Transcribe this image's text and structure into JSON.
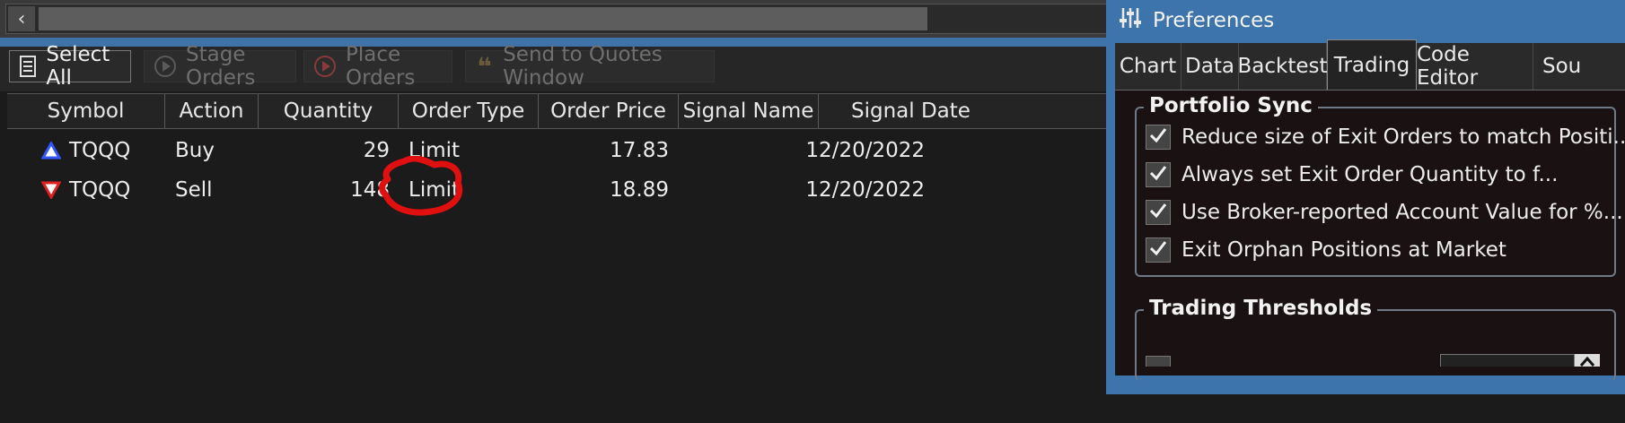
{
  "toolbar": {
    "select_all": "Select All",
    "stage_orders": "Stage Orders",
    "place_orders": "Place Orders",
    "send_to_quotes": "Send to Quotes Window"
  },
  "table": {
    "headers": [
      "Symbol",
      "Action",
      "Quantity",
      "Order Type",
      "Order Price",
      "Signal Name",
      "Signal Date"
    ],
    "rows": [
      {
        "direction": "up",
        "symbol": "TQQQ",
        "action": "Buy",
        "quantity": "29",
        "order_type": "Limit",
        "order_price": "17.83",
        "signal_name": "",
        "signal_date": "12/20/2022"
      },
      {
        "direction": "down",
        "symbol": "TQQQ",
        "action": "Sell",
        "quantity": "148",
        "order_type": "Limit",
        "order_price": "18.89",
        "signal_name": "",
        "signal_date": "12/20/2022"
      }
    ]
  },
  "prefs": {
    "title": "Preferences",
    "tabs": [
      "Chart",
      "Data",
      "Backtest",
      "Trading",
      "Code Editor",
      "Sou"
    ],
    "active_tab": "Trading",
    "portfolio_sync": {
      "title": "Portfolio Sync",
      "options": [
        {
          "label": "Reduce size of Exit Orders to match Positi...",
          "checked": true
        },
        {
          "label": "Always set Exit Order Quantity to f...",
          "checked": true
        },
        {
          "label": "Use Broker-reported Account Value for %...",
          "checked": true
        },
        {
          "label": "Exit Orphan Positions at Market",
          "checked": true
        }
      ]
    },
    "trading_thresholds": {
      "title": "Trading Thresholds"
    }
  },
  "colors": {
    "accent": "#3d74ab",
    "annotation": "#e01010",
    "buy_arrow": "#3355ff",
    "sell_arrow": "#e02020"
  }
}
